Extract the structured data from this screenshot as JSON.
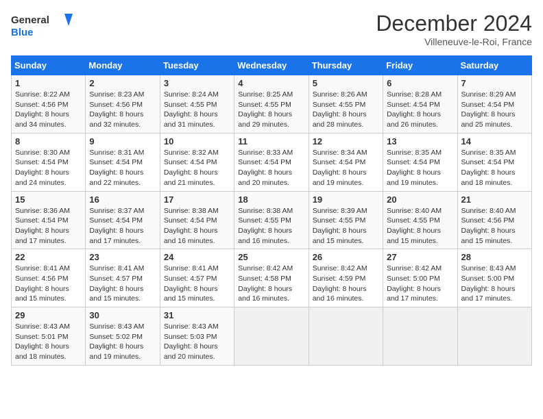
{
  "header": {
    "logo_line1": "General",
    "logo_line2": "Blue",
    "month_year": "December 2024",
    "location": "Villeneuve-le-Roi, France"
  },
  "weekdays": [
    "Sunday",
    "Monday",
    "Tuesday",
    "Wednesday",
    "Thursday",
    "Friday",
    "Saturday"
  ],
  "weeks": [
    [
      {
        "day": "1",
        "sunrise": "Sunrise: 8:22 AM",
        "sunset": "Sunset: 4:56 PM",
        "daylight": "Daylight: 8 hours and 34 minutes."
      },
      {
        "day": "2",
        "sunrise": "Sunrise: 8:23 AM",
        "sunset": "Sunset: 4:56 PM",
        "daylight": "Daylight: 8 hours and 32 minutes."
      },
      {
        "day": "3",
        "sunrise": "Sunrise: 8:24 AM",
        "sunset": "Sunset: 4:55 PM",
        "daylight": "Daylight: 8 hours and 31 minutes."
      },
      {
        "day": "4",
        "sunrise": "Sunrise: 8:25 AM",
        "sunset": "Sunset: 4:55 PM",
        "daylight": "Daylight: 8 hours and 29 minutes."
      },
      {
        "day": "5",
        "sunrise": "Sunrise: 8:26 AM",
        "sunset": "Sunset: 4:55 PM",
        "daylight": "Daylight: 8 hours and 28 minutes."
      },
      {
        "day": "6",
        "sunrise": "Sunrise: 8:28 AM",
        "sunset": "Sunset: 4:54 PM",
        "daylight": "Daylight: 8 hours and 26 minutes."
      },
      {
        "day": "7",
        "sunrise": "Sunrise: 8:29 AM",
        "sunset": "Sunset: 4:54 PM",
        "daylight": "Daylight: 8 hours and 25 minutes."
      }
    ],
    [
      {
        "day": "8",
        "sunrise": "Sunrise: 8:30 AM",
        "sunset": "Sunset: 4:54 PM",
        "daylight": "Daylight: 8 hours and 24 minutes."
      },
      {
        "day": "9",
        "sunrise": "Sunrise: 8:31 AM",
        "sunset": "Sunset: 4:54 PM",
        "daylight": "Daylight: 8 hours and 22 minutes."
      },
      {
        "day": "10",
        "sunrise": "Sunrise: 8:32 AM",
        "sunset": "Sunset: 4:54 PM",
        "daylight": "Daylight: 8 hours and 21 minutes."
      },
      {
        "day": "11",
        "sunrise": "Sunrise: 8:33 AM",
        "sunset": "Sunset: 4:54 PM",
        "daylight": "Daylight: 8 hours and 20 minutes."
      },
      {
        "day": "12",
        "sunrise": "Sunrise: 8:34 AM",
        "sunset": "Sunset: 4:54 PM",
        "daylight": "Daylight: 8 hours and 19 minutes."
      },
      {
        "day": "13",
        "sunrise": "Sunrise: 8:35 AM",
        "sunset": "Sunset: 4:54 PM",
        "daylight": "Daylight: 8 hours and 19 minutes."
      },
      {
        "day": "14",
        "sunrise": "Sunrise: 8:35 AM",
        "sunset": "Sunset: 4:54 PM",
        "daylight": "Daylight: 8 hours and 18 minutes."
      }
    ],
    [
      {
        "day": "15",
        "sunrise": "Sunrise: 8:36 AM",
        "sunset": "Sunset: 4:54 PM",
        "daylight": "Daylight: 8 hours and 17 minutes."
      },
      {
        "day": "16",
        "sunrise": "Sunrise: 8:37 AM",
        "sunset": "Sunset: 4:54 PM",
        "daylight": "Daylight: 8 hours and 17 minutes."
      },
      {
        "day": "17",
        "sunrise": "Sunrise: 8:38 AM",
        "sunset": "Sunset: 4:54 PM",
        "daylight": "Daylight: 8 hours and 16 minutes."
      },
      {
        "day": "18",
        "sunrise": "Sunrise: 8:38 AM",
        "sunset": "Sunset: 4:55 PM",
        "daylight": "Daylight: 8 hours and 16 minutes."
      },
      {
        "day": "19",
        "sunrise": "Sunrise: 8:39 AM",
        "sunset": "Sunset: 4:55 PM",
        "daylight": "Daylight: 8 hours and 15 minutes."
      },
      {
        "day": "20",
        "sunrise": "Sunrise: 8:40 AM",
        "sunset": "Sunset: 4:55 PM",
        "daylight": "Daylight: 8 hours and 15 minutes."
      },
      {
        "day": "21",
        "sunrise": "Sunrise: 8:40 AM",
        "sunset": "Sunset: 4:56 PM",
        "daylight": "Daylight: 8 hours and 15 minutes."
      }
    ],
    [
      {
        "day": "22",
        "sunrise": "Sunrise: 8:41 AM",
        "sunset": "Sunset: 4:56 PM",
        "daylight": "Daylight: 8 hours and 15 minutes."
      },
      {
        "day": "23",
        "sunrise": "Sunrise: 8:41 AM",
        "sunset": "Sunset: 4:57 PM",
        "daylight": "Daylight: 8 hours and 15 minutes."
      },
      {
        "day": "24",
        "sunrise": "Sunrise: 8:41 AM",
        "sunset": "Sunset: 4:57 PM",
        "daylight": "Daylight: 8 hours and 15 minutes."
      },
      {
        "day": "25",
        "sunrise": "Sunrise: 8:42 AM",
        "sunset": "Sunset: 4:58 PM",
        "daylight": "Daylight: 8 hours and 16 minutes."
      },
      {
        "day": "26",
        "sunrise": "Sunrise: 8:42 AM",
        "sunset": "Sunset: 4:59 PM",
        "daylight": "Daylight: 8 hours and 16 minutes."
      },
      {
        "day": "27",
        "sunrise": "Sunrise: 8:42 AM",
        "sunset": "Sunset: 5:00 PM",
        "daylight": "Daylight: 8 hours and 17 minutes."
      },
      {
        "day": "28",
        "sunrise": "Sunrise: 8:43 AM",
        "sunset": "Sunset: 5:00 PM",
        "daylight": "Daylight: 8 hours and 17 minutes."
      }
    ],
    [
      {
        "day": "29",
        "sunrise": "Sunrise: 8:43 AM",
        "sunset": "Sunset: 5:01 PM",
        "daylight": "Daylight: 8 hours and 18 minutes."
      },
      {
        "day": "30",
        "sunrise": "Sunrise: 8:43 AM",
        "sunset": "Sunset: 5:02 PM",
        "daylight": "Daylight: 8 hours and 19 minutes."
      },
      {
        "day": "31",
        "sunrise": "Sunrise: 8:43 AM",
        "sunset": "Sunset: 5:03 PM",
        "daylight": "Daylight: 8 hours and 20 minutes."
      },
      null,
      null,
      null,
      null
    ]
  ]
}
